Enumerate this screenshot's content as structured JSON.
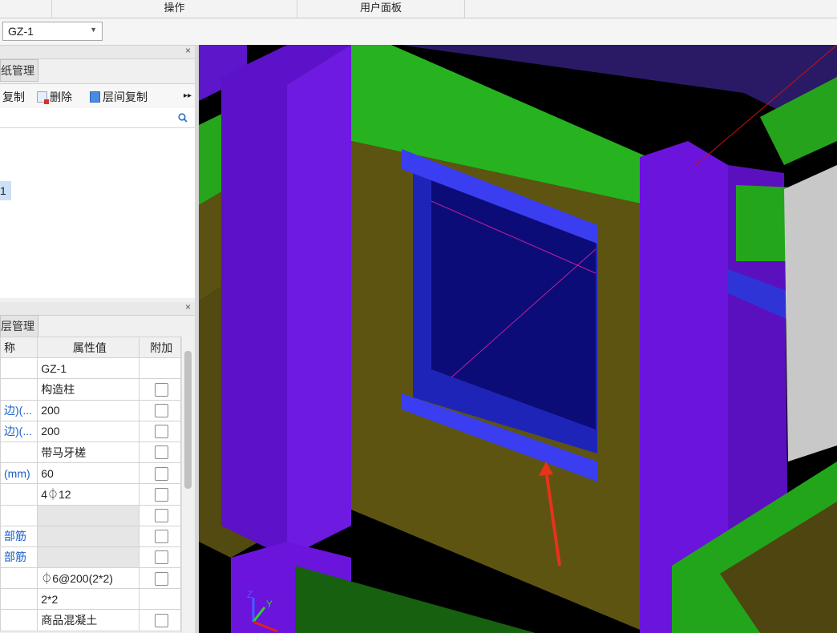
{
  "ribbon": {
    "groups": [
      "操作",
      "用户面板"
    ]
  },
  "selector": {
    "component": "GZ-1"
  },
  "drawing_panel": {
    "tab": "纸管理",
    "toolbar": {
      "copy": "复制",
      "delete": "删除",
      "floor_copy": "层间复制"
    },
    "selected_item": "1"
  },
  "property_panel": {
    "tab": "层管理",
    "headers": {
      "name": "称",
      "value": "属性值",
      "extra": "附加"
    },
    "rows": [
      {
        "name": "",
        "value": "GZ-1"
      },
      {
        "name": "",
        "value": "构造柱"
      },
      {
        "name": "边)(...",
        "value": "200"
      },
      {
        "name": "边)(...",
        "value": "200"
      },
      {
        "name": "",
        "value": "带马牙槎"
      },
      {
        "name": "(mm)",
        "value": "60"
      },
      {
        "name": "",
        "value": "4⏀12"
      },
      {
        "name": "",
        "value": ""
      },
      {
        "name": "部筋",
        "value": ""
      },
      {
        "name": "部筋",
        "value": ""
      },
      {
        "name": "",
        "value": "⏀6@200(2*2)"
      },
      {
        "name": "",
        "value": "2*2"
      },
      {
        "name": "",
        "value": "商品混凝土"
      }
    ]
  },
  "viewport": {
    "axis_labels": {
      "z": "Z",
      "y": "Y"
    },
    "background": "#000000",
    "colors": {
      "column": "#6b10d6",
      "beam": "#22a81e",
      "wall": "#5e5412",
      "window": "#2d33d8"
    }
  }
}
